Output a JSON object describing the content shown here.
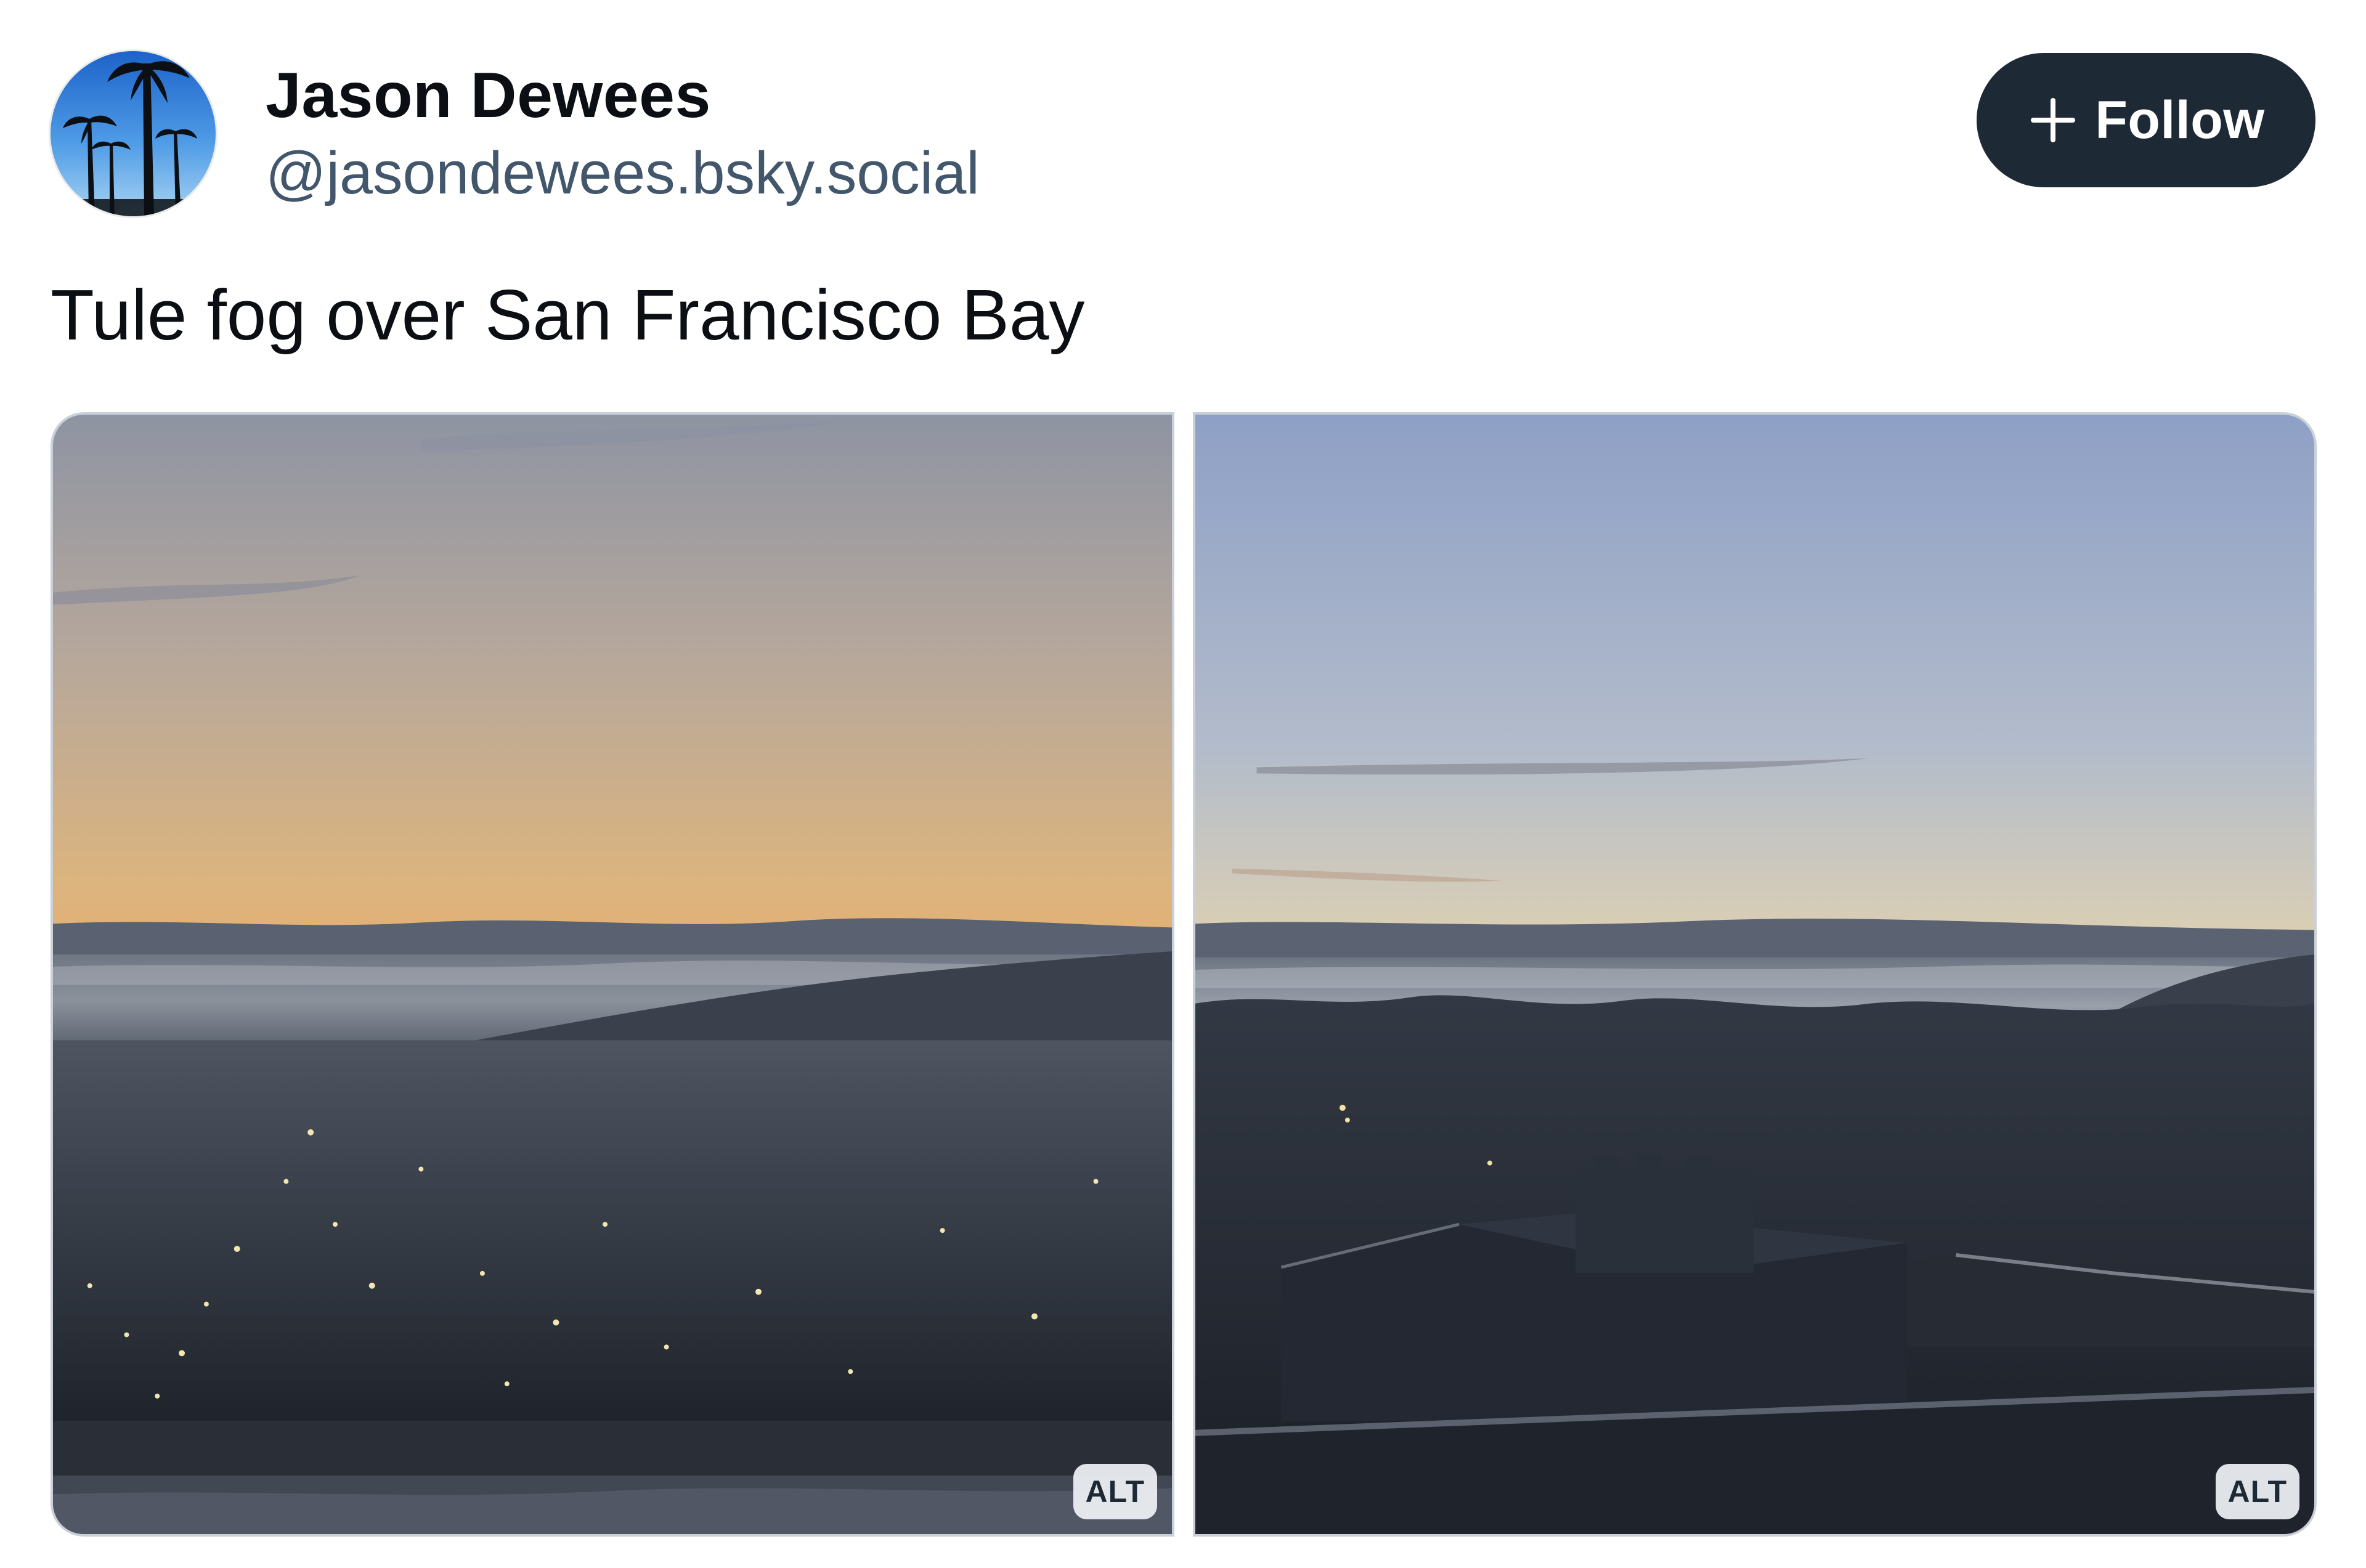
{
  "post": {
    "author": {
      "display_name": "Jason Dewees",
      "handle": "@jasondewees.bsky.social",
      "avatar_icon": "palm-trees-avatar"
    },
    "follow_button": {
      "label": "Follow",
      "icon": "plus-icon",
      "background": "#1e2936",
      "text_color": "#ffffff"
    },
    "text": "Tule fog over San Francisco Bay",
    "images": [
      {
        "alt_badge": "ALT"
      },
      {
        "alt_badge": "ALT"
      }
    ]
  },
  "colors": {
    "name": "#0b0f14",
    "handle": "#42576c",
    "image_border": "#c9d0d8"
  }
}
